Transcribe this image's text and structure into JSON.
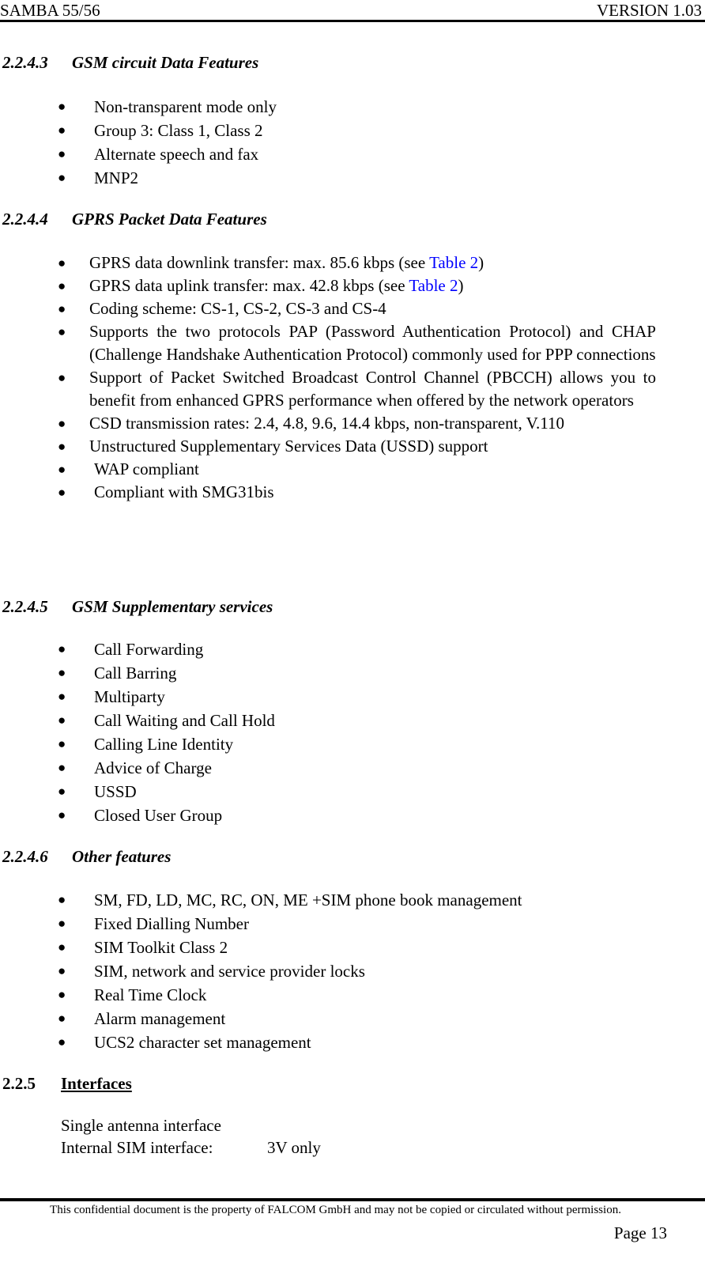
{
  "header": {
    "left": "SAMBA 55/56",
    "right": "VERSION 1.03"
  },
  "sections": {
    "s2243": {
      "number": "2.2.4.3",
      "title": "GSM circuit Data Features",
      "items": [
        "Non-transparent mode only",
        "Group 3: Class 1, Class 2",
        "Alternate speech and fax",
        "MNP2"
      ]
    },
    "s2244": {
      "number": "2.2.4.4",
      "title": "GPRS Packet Data Features",
      "items": [
        {
          "pre": "GPRS data downlink transfer: max. 85.6 kbps (see ",
          "link": "Table 2",
          "post": ")"
        },
        {
          "pre": "GPRS data uplink transfer: max. 42.8 kbps (see ",
          "link": "Table 2",
          "post": ")"
        },
        {
          "text": "Coding scheme: CS-1, CS-2, CS-3 and CS-4"
        },
        {
          "text": "Supports the two protocols PAP (Password Authentication Protocol) and CHAP (Challenge Handshake Authentication Protocol) commonly used for PPP connections"
        },
        {
          "text": "Support of Packet Switched Broadcast Control Channel (PBCCH) allows you to benefit from enhanced GPRS performance when offered by the network operators"
        },
        {
          "text": "CSD transmission rates: 2.4, 4.8, 9.6, 14.4 kbps, non-transparent, V.110"
        },
        {
          "text": "Unstructured Supplementary Services Data (USSD) support"
        },
        {
          "text": "WAP compliant"
        },
        {
          "text": "Compliant with SMG31bis"
        }
      ]
    },
    "s2245": {
      "number": "2.2.4.5",
      "title": "GSM Supplementary services",
      "items": [
        "Call Forwarding",
        "Call Barring",
        "Multiparty",
        "Call Waiting and Call Hold",
        "Calling Line Identity",
        "Advice of Charge",
        "USSD",
        "Closed User Group"
      ]
    },
    "s2246": {
      "number": "2.2.4.6",
      "title": "Other features",
      "items": [
        "SM, FD, LD, MC, RC, ON, ME +SIM phone book management",
        "Fixed Dialling Number",
        "SIM Toolkit Class 2",
        "SIM, network and service provider locks",
        "Real Time Clock",
        "Alarm management",
        "UCS2 character set management"
      ]
    },
    "s225": {
      "number": "2.2.5",
      "title": "Interfaces",
      "line1": "Single antenna interface",
      "line2_label": "Internal SIM interface:",
      "line2_value": "3V only"
    }
  },
  "footer": {
    "notice": "This confidential document is the property of FALCOM GmbH and may not be copied or circulated without permission.",
    "page": "Page 13"
  },
  "colors": {
    "link": "#0000ff"
  }
}
